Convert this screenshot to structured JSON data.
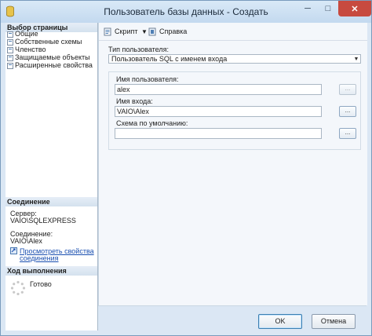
{
  "window": {
    "title": "Пользователь базы данных - Создать",
    "minimize": "─",
    "maximize": "□",
    "close": "✕"
  },
  "left": {
    "pages_header": "Выбор страницы",
    "pages": [
      "Общие",
      "Собственные схемы",
      "Членство",
      "Защищаемые объекты",
      "Расширенные свойства"
    ],
    "connection_header": "Соединение",
    "server_label": "Сервер:",
    "server_value": "VAIO\\SQLEXPRESS",
    "connection_label": "Соединение:",
    "connection_value": "VAIO\\Alex",
    "view_link_line1": "Просмотреть свойства",
    "view_link_line2": "соединения",
    "progress_header": "Ход выполнения",
    "progress_status": "Готово"
  },
  "toolbar": {
    "script_label": "Скрипт",
    "dropdown_arrow": "▼",
    "help_label": "Справка"
  },
  "form": {
    "user_type_label": "Тип пользователя:",
    "user_type_value": "Пользователь SQL с именем входа",
    "combo_arrow": "▼",
    "username_label": "Имя пользователя:",
    "username_value": "alex",
    "login_label": "Имя входа:",
    "login_value": "VAIO\\Alex",
    "default_schema_label": "Схема по умолчанию:",
    "default_schema_value": "",
    "browse_label": "..."
  },
  "buttons": {
    "ok": "OK",
    "cancel": "Отмена"
  }
}
